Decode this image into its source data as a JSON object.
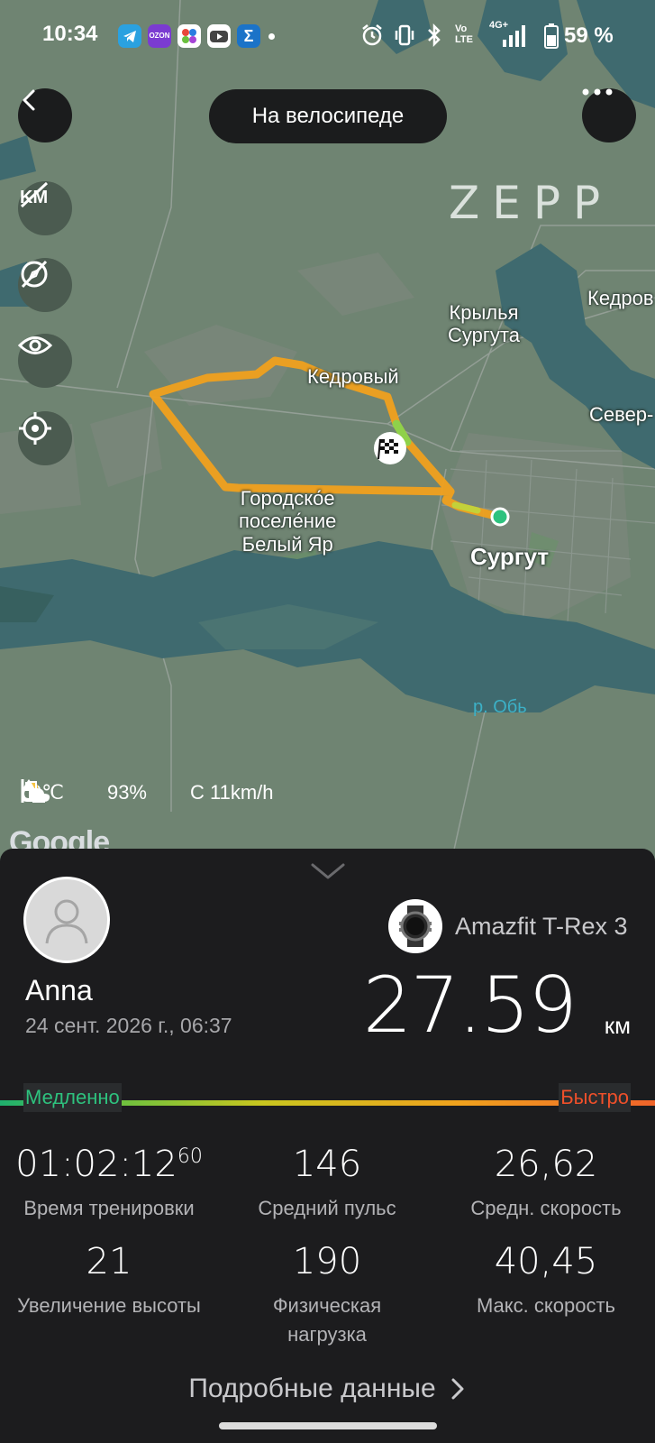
{
  "status_bar": {
    "time": "10:34",
    "apps": [
      "telegram-icon",
      "ozon-icon",
      "vk-icon",
      "youtube-icon",
      "sigma-icon"
    ],
    "ozon_label": "OZON",
    "sigma_label": "Σ",
    "volte_label": "Vo\nLTE",
    "network_label": "4G+",
    "battery": "59 %"
  },
  "header": {
    "activity_title": "На велосипеде",
    "brand": "ZEPP"
  },
  "side_controls": [
    "km-toggle-icon",
    "compass-off-icon",
    "eye-icon",
    "locate-icon"
  ],
  "map": {
    "labels": {
      "kedrovy_top": "Кедров",
      "krylya": "Крылья\nСургута",
      "kedrovy": "Кедровый",
      "sever": "Север-",
      "beliy_yar": "Городско́е\nпоселе́ние\nБелый Яр",
      "surgut": "Сургут",
      "ob": "р. Обь"
    },
    "attribution": "Google"
  },
  "weather": {
    "temperature": "9℃",
    "humidity": "93%",
    "wind": "С 11km/h"
  },
  "summary": {
    "user_name": "Anna",
    "date": "24 сент. 2026 г., 06:37",
    "device_name": "Amazfit T-Rex 3",
    "distance": "27.59",
    "distance_unit": "км"
  },
  "speed_legend": {
    "slow": "Медленно",
    "fast": "Быстро"
  },
  "stats": {
    "duration_main": "01:02:12",
    "duration_fraction": "60",
    "duration_label": "Время тренировки",
    "avg_hr": "146",
    "avg_hr_label": "Средний пульс",
    "avg_speed": "26,62",
    "avg_speed_label": "Средн. скорость",
    "elevation_gain": "21",
    "elevation_gain_label": "Увеличение высоты",
    "training_load": "190",
    "training_load_label": "Физическая\nнагрузка",
    "max_speed": "40,45",
    "max_speed_label": "Макс. скорость"
  },
  "footer": {
    "more_details": "Подробные данные"
  },
  "colors": {
    "map_land": "#6f8472",
    "map_water": "#3f6a6f",
    "route": "#f39c1f",
    "panel": "#1c1c1e",
    "slow": "#2ec27e",
    "fast": "#f0502a"
  }
}
